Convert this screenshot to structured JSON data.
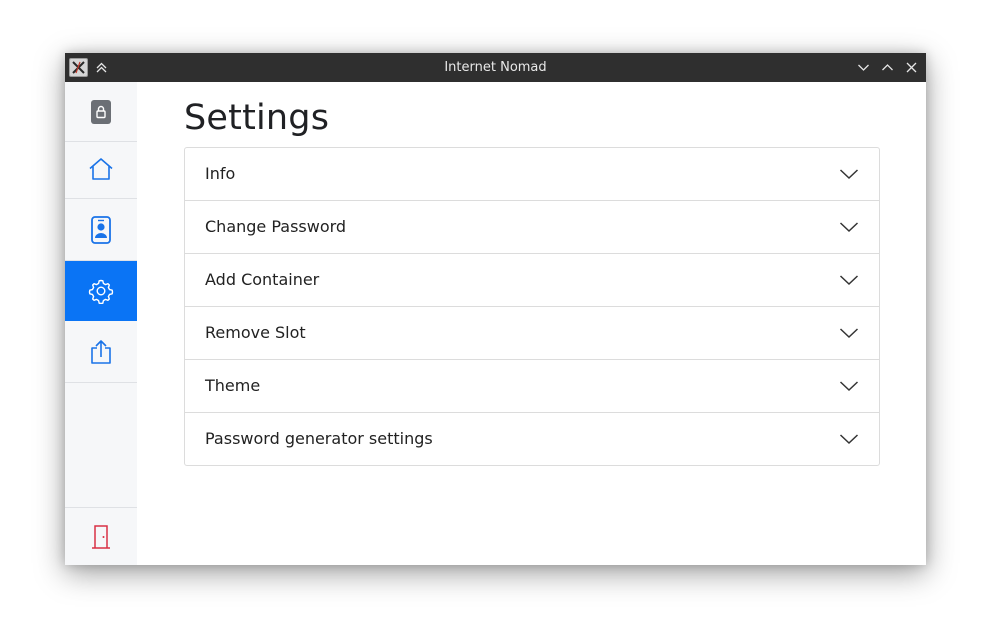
{
  "window": {
    "title": "Internet Nomad"
  },
  "sidebar": {
    "items": [
      {
        "icon": "lock-icon"
      },
      {
        "icon": "home-icon"
      },
      {
        "icon": "contact-card-icon"
      },
      {
        "icon": "gear-icon",
        "active": true
      },
      {
        "icon": "upload-icon"
      }
    ],
    "footer_icon": "door-exit-icon"
  },
  "main": {
    "title": "Settings",
    "sections": [
      {
        "label": "Info"
      },
      {
        "label": "Change Password"
      },
      {
        "label": "Add Container"
      },
      {
        "label": "Remove Slot"
      },
      {
        "label": "Theme"
      },
      {
        "label": "Password generator settings"
      }
    ]
  },
  "colors": {
    "accent": "#0a74f5",
    "titlebar": "#2f2f2f",
    "sidebar_bg": "#f6f7f9",
    "icon_blue": "#1a73e8",
    "exit_red": "#d93045",
    "lock_gray": "#6b6f75"
  }
}
